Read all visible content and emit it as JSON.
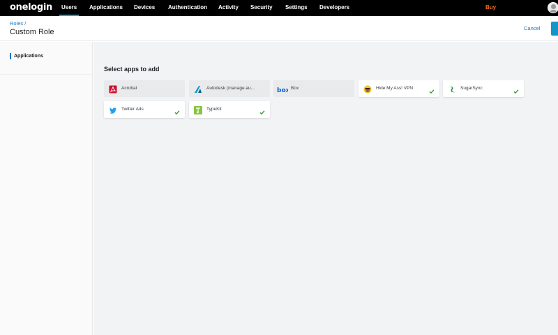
{
  "brand": {
    "logo_text": "onelogin",
    "accent": "#00a9e0",
    "link_color": "#1b75bc",
    "check_color": "#3d9a2f",
    "buy_color": "#f26f21"
  },
  "nav": {
    "items": [
      {
        "label": "Users",
        "active": true
      },
      {
        "label": "Applications"
      },
      {
        "label": "Devices"
      },
      {
        "label": "Authentication"
      },
      {
        "label": "Activity"
      },
      {
        "label": "Security"
      },
      {
        "label": "Settings"
      },
      {
        "label": "Developers"
      }
    ],
    "buy_label": "Buy",
    "avatar_icon": "user-avatar-icon"
  },
  "header": {
    "breadcrumb_link": "Roles",
    "breadcrumb_separator": "/",
    "title": "Custom Role",
    "cancel_label": "Cancel"
  },
  "sidebar": {
    "items": [
      {
        "label": "Applications",
        "active": true
      }
    ]
  },
  "main": {
    "section_title": "Select apps to add",
    "apps": [
      {
        "name": "Acrobat",
        "icon": "acrobat-icon",
        "selected": false
      },
      {
        "name": "Autodesk (manage.au...",
        "icon": "autodesk-icon",
        "selected": false
      },
      {
        "name": "Box",
        "icon": "box-icon",
        "selected": false
      },
      {
        "name": "Hide My Ass! VPN",
        "icon": "hidemyass-icon",
        "selected": true
      },
      {
        "name": "SugarSync",
        "icon": "sugarsync-icon",
        "selected": true
      },
      {
        "name": "Twitter Ads",
        "icon": "twitter-icon",
        "selected": true
      },
      {
        "name": "TypeKit",
        "icon": "typekit-icon",
        "selected": true
      }
    ]
  }
}
